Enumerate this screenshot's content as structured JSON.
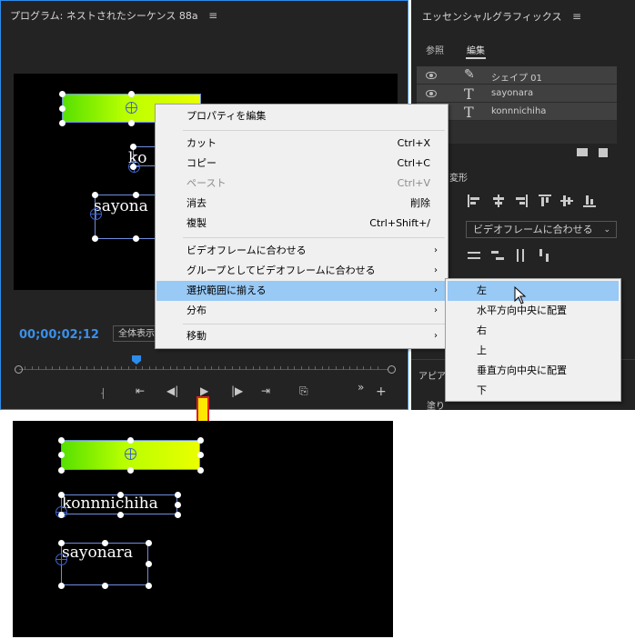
{
  "program": {
    "title": "プログラム: ネストされたシーケンス 88a",
    "menu_glyph": "≡",
    "timecode": "00;00;02;12",
    "zoom_label": "全体表示",
    "canvas_texts": {
      "kon_partial": "ko",
      "sayo_partial": "sayona"
    }
  },
  "essential_graphics": {
    "title": "エッセンシャルグラフィックス",
    "menu_glyph": "≡",
    "tabs": [
      {
        "label": "参照"
      },
      {
        "label": "編集"
      }
    ],
    "layers": [
      {
        "name": "シェイプ 01",
        "icon": "pen-icon"
      },
      {
        "name": "sayonara",
        "icon": "text-icon"
      },
      {
        "name": "konnnichiha",
        "icon": "text-icon"
      }
    ],
    "section_partial": "変形",
    "align_dropdown": "ビデオフレームに合わせる",
    "appearance_partial": "アピア",
    "fill_partial": "塗り"
  },
  "context_menu": {
    "items": [
      {
        "label": "プロパティを編集",
        "shortcut": ""
      },
      {
        "label": "カット",
        "shortcut": "Ctrl+X"
      },
      {
        "label": "コピー",
        "shortcut": "Ctrl+C"
      },
      {
        "label": "ペースト",
        "shortcut": "Ctrl+V"
      },
      {
        "label": "消去",
        "shortcut": "削除"
      },
      {
        "label": "複製",
        "shortcut": "Ctrl+Shift+/"
      },
      {
        "label": "ビデオフレームに合わせる",
        "shortcut": ""
      },
      {
        "label": "グループとしてビデオフレームに合わせる",
        "shortcut": ""
      },
      {
        "label": "選択範囲に揃える",
        "shortcut": ""
      },
      {
        "label": "分布",
        "shortcut": ""
      },
      {
        "label": "移動",
        "shortcut": ""
      }
    ],
    "submenu_arrow": "›"
  },
  "submenu": {
    "items": [
      {
        "label": "左"
      },
      {
        "label": "水平方向中央に配置"
      },
      {
        "label": "右"
      },
      {
        "label": "上"
      },
      {
        "label": "垂直方向中央に配置"
      },
      {
        "label": "下"
      }
    ]
  },
  "result": {
    "text1": "konnnichiha",
    "text2": "sayonara"
  },
  "colors": {
    "accent_blue": "#2d8ceb",
    "highlight": "#99c9f5",
    "arrow_yellow": "#ffe800",
    "arrow_red": "#e02020"
  }
}
